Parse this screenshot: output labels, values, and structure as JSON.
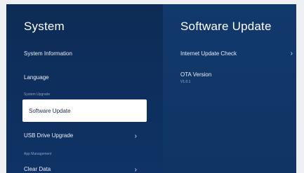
{
  "left_panel": {
    "title": "System",
    "items": [
      {
        "label": "System Information"
      },
      {
        "label": "Language"
      },
      {
        "label": "Software Update"
      },
      {
        "label": "USB Drive Upgrade",
        "chevron": "›"
      },
      {
        "label": "Clear Data",
        "chevron": "›"
      }
    ],
    "sections": [
      "System Upgrade",
      "App Management"
    ]
  },
  "right_panel": {
    "title": "Software Update",
    "items": [
      {
        "label": "Internet Update Check",
        "chevron": "›"
      },
      {
        "label": "OTA Version",
        "value": "V1.0.1"
      }
    ]
  },
  "colors": {
    "left_bg": "#0d2b55",
    "right_bg": "#12396c",
    "selected_bg": "#ffffff",
    "text": "#e9eef7"
  }
}
